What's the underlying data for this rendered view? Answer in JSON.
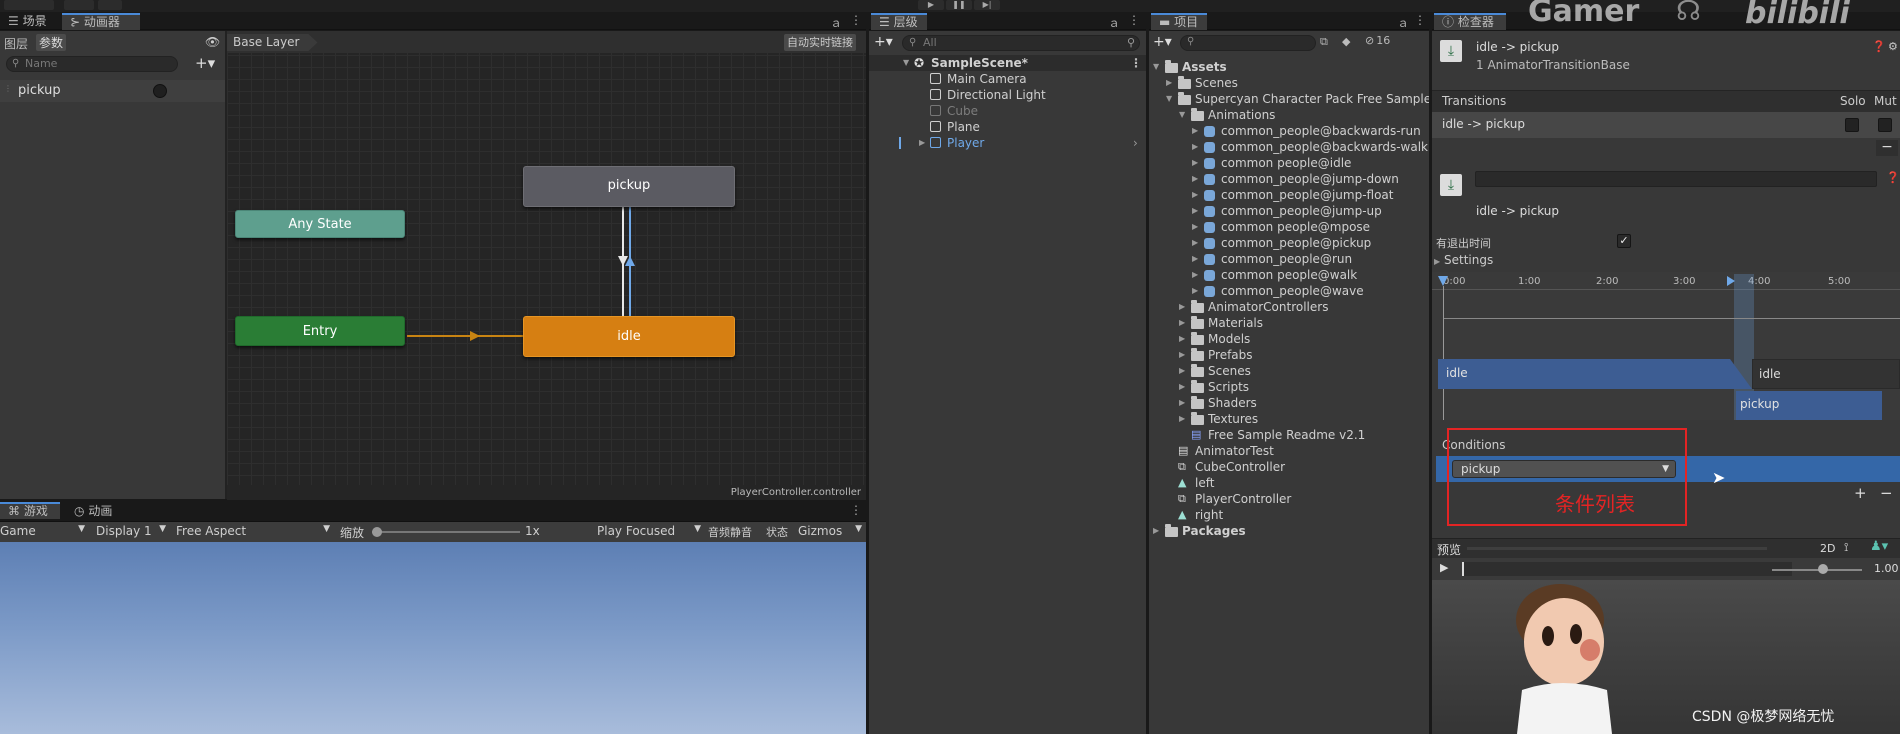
{
  "top": {
    "watermark_brand": "Gamer",
    "watermark_logo": "bilibili",
    "csdn_watermark": "CSDN @极梦网络无忧"
  },
  "scene_tabs": {
    "scene": "场景",
    "animator": "动画器"
  },
  "animator": {
    "sub_tabs": {
      "layers": "图层",
      "params": "参数"
    },
    "search_placeholder": "Name",
    "params": [
      {
        "name": "pickup"
      }
    ],
    "breadcrumb": "Base Layer",
    "live_link": "自动实时链接",
    "footer_file": "PlayerController.controller",
    "nodes": {
      "any_state": "Any State",
      "entry": "Entry",
      "pickup": "pickup",
      "idle": "idle"
    }
  },
  "game": {
    "tab_game": "游戏",
    "tab_anim": "动画",
    "toolbar": {
      "game": "Game",
      "display": "Display 1",
      "aspect": "Free Aspect",
      "scale_label": "缩放",
      "scale_value": "1x",
      "play_focused": "Play Focused",
      "mute": "音频静音",
      "stats": "状态",
      "gizmos": "Gizmos"
    }
  },
  "hierarchy": {
    "tab": "层级",
    "search_placeholder": "All",
    "scene": "SampleScene*",
    "items": [
      {
        "label": "Main Camera",
        "disabled": false,
        "selected": false
      },
      {
        "label": "Directional Light",
        "disabled": false,
        "selected": false
      },
      {
        "label": "Cube",
        "disabled": true,
        "selected": false
      },
      {
        "label": "Plane",
        "disabled": false,
        "selected": false
      },
      {
        "label": "Player",
        "disabled": false,
        "selected": true
      }
    ]
  },
  "project": {
    "tab": "项目",
    "count": "16",
    "tree": [
      {
        "label": "Assets",
        "depth": 0,
        "icon": "folder-open",
        "arrow": "down",
        "bold": true
      },
      {
        "label": "Scenes",
        "depth": 1,
        "icon": "folder",
        "arrow": "right"
      },
      {
        "label": "Supercyan Character Pack Free Sample",
        "depth": 1,
        "icon": "folder-open",
        "arrow": "down"
      },
      {
        "label": "Animations",
        "depth": 2,
        "icon": "folder-open",
        "arrow": "down"
      },
      {
        "label": "common_people@backwards-run",
        "depth": 3,
        "icon": "clip",
        "arrow": "right"
      },
      {
        "label": "common_people@backwards-walk",
        "depth": 3,
        "icon": "clip",
        "arrow": "right"
      },
      {
        "label": "common people@idle",
        "depth": 3,
        "icon": "clip",
        "arrow": "right"
      },
      {
        "label": "common_people@jump-down",
        "depth": 3,
        "icon": "clip",
        "arrow": "right"
      },
      {
        "label": "common_people@jump-float",
        "depth": 3,
        "icon": "clip",
        "arrow": "right"
      },
      {
        "label": "common_people@jump-up",
        "depth": 3,
        "icon": "clip",
        "arrow": "right"
      },
      {
        "label": "common people@mpose",
        "depth": 3,
        "icon": "clip",
        "arrow": "right"
      },
      {
        "label": "common_people@pickup",
        "depth": 3,
        "icon": "clip",
        "arrow": "right"
      },
      {
        "label": "common_people@run",
        "depth": 3,
        "icon": "clip",
        "arrow": "right"
      },
      {
        "label": "common people@walk",
        "depth": 3,
        "icon": "clip",
        "arrow": "right"
      },
      {
        "label": "common_people@wave",
        "depth": 3,
        "icon": "clip",
        "arrow": "right"
      },
      {
        "label": "AnimatorControllers",
        "depth": 2,
        "icon": "folder",
        "arrow": "right"
      },
      {
        "label": "Materials",
        "depth": 2,
        "icon": "folder",
        "arrow": "right"
      },
      {
        "label": "Models",
        "depth": 2,
        "icon": "folder",
        "arrow": "right"
      },
      {
        "label": "Prefabs",
        "depth": 2,
        "icon": "folder",
        "arrow": "right"
      },
      {
        "label": "Scenes",
        "depth": 2,
        "icon": "folder",
        "arrow": "right"
      },
      {
        "label": "Scripts",
        "depth": 2,
        "icon": "folder",
        "arrow": "right"
      },
      {
        "label": "Shaders",
        "depth": 2,
        "icon": "folder",
        "arrow": "right"
      },
      {
        "label": "Textures",
        "depth": 2,
        "icon": "folder",
        "arrow": "right"
      },
      {
        "label": "Free Sample Readme v2.1",
        "depth": 2,
        "icon": "doc",
        "arrow": ""
      },
      {
        "label": "AnimatorTest",
        "depth": 1,
        "icon": "script",
        "arrow": ""
      },
      {
        "label": "CubeController",
        "depth": 1,
        "icon": "controller",
        "arrow": ""
      },
      {
        "label": "left",
        "depth": 1,
        "icon": "anim",
        "arrow": ""
      },
      {
        "label": "PlayerController",
        "depth": 1,
        "icon": "controller",
        "arrow": ""
      },
      {
        "label": "right",
        "depth": 1,
        "icon": "anim",
        "arrow": ""
      },
      {
        "label": "Packages",
        "depth": 0,
        "icon": "folder",
        "arrow": "right",
        "bold": true
      }
    ]
  },
  "inspector": {
    "tab": "检查器",
    "title": "idle -> pickup",
    "subtitle": "1 AnimatorTransitionBase",
    "transitions_header": "Transitions",
    "solo": "Solo",
    "mute": "Mut",
    "transition_row": "idle -> pickup",
    "transition_name": "idle -> pickup",
    "has_exit_time": "有退出时间",
    "settings": "Settings",
    "timeline_ticks": [
      "0:00",
      "1:00",
      "2:00",
      "3:00",
      "4:00",
      "5:00"
    ],
    "clip_idle": "idle",
    "clip_idle_2": "idle",
    "clip_pickup": "pickup",
    "conditions": "Conditions",
    "condition_value": "pickup",
    "annotation": "条件列表",
    "preview": "预览",
    "preview_2d": "2D",
    "preview_speed": "1.00"
  }
}
